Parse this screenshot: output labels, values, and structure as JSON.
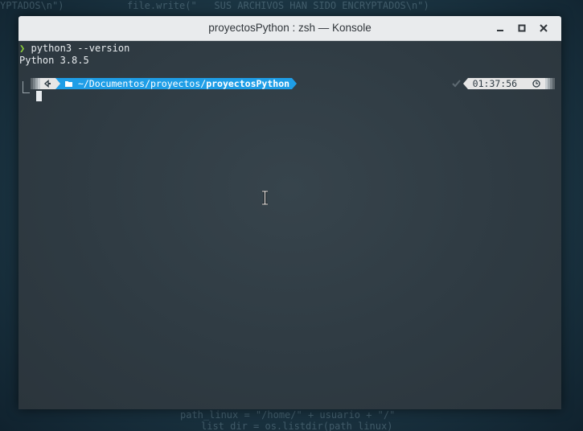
{
  "background_code": {
    "line1": "YPTADOS\\n\")",
    "line2": "file.write(\"   SUS ARCHIVOS HAN SIDO ENCRYPTADOS\\n\")",
    "line3": "path_linux = \"/home/\" + usuario + \"/\"",
    "line4": "list_dir = os.listdir(path_linux)"
  },
  "window": {
    "title": "proyectosPython : zsh — Konsole",
    "controls": {
      "minimize": "minimize-icon",
      "maximize": "maximize-icon",
      "close": "close-icon"
    }
  },
  "terminal": {
    "prompt_symbol": "❯",
    "command": "python3 --version",
    "output": "Python 3.8.5",
    "prompt": {
      "os_icon": "linux-icon",
      "folder_icon": "folder-icon",
      "path_prefix": "~/Documentos/proyectos/",
      "path_current": "proyectosPython",
      "status_icon": "check-icon",
      "time": "01:37:56",
      "clock_icon": "clock-icon"
    }
  },
  "colors": {
    "path_segment": "#1f9ee7",
    "time_segment": "#e6e6e6",
    "prompt_arrow": "#8ccf3a"
  }
}
